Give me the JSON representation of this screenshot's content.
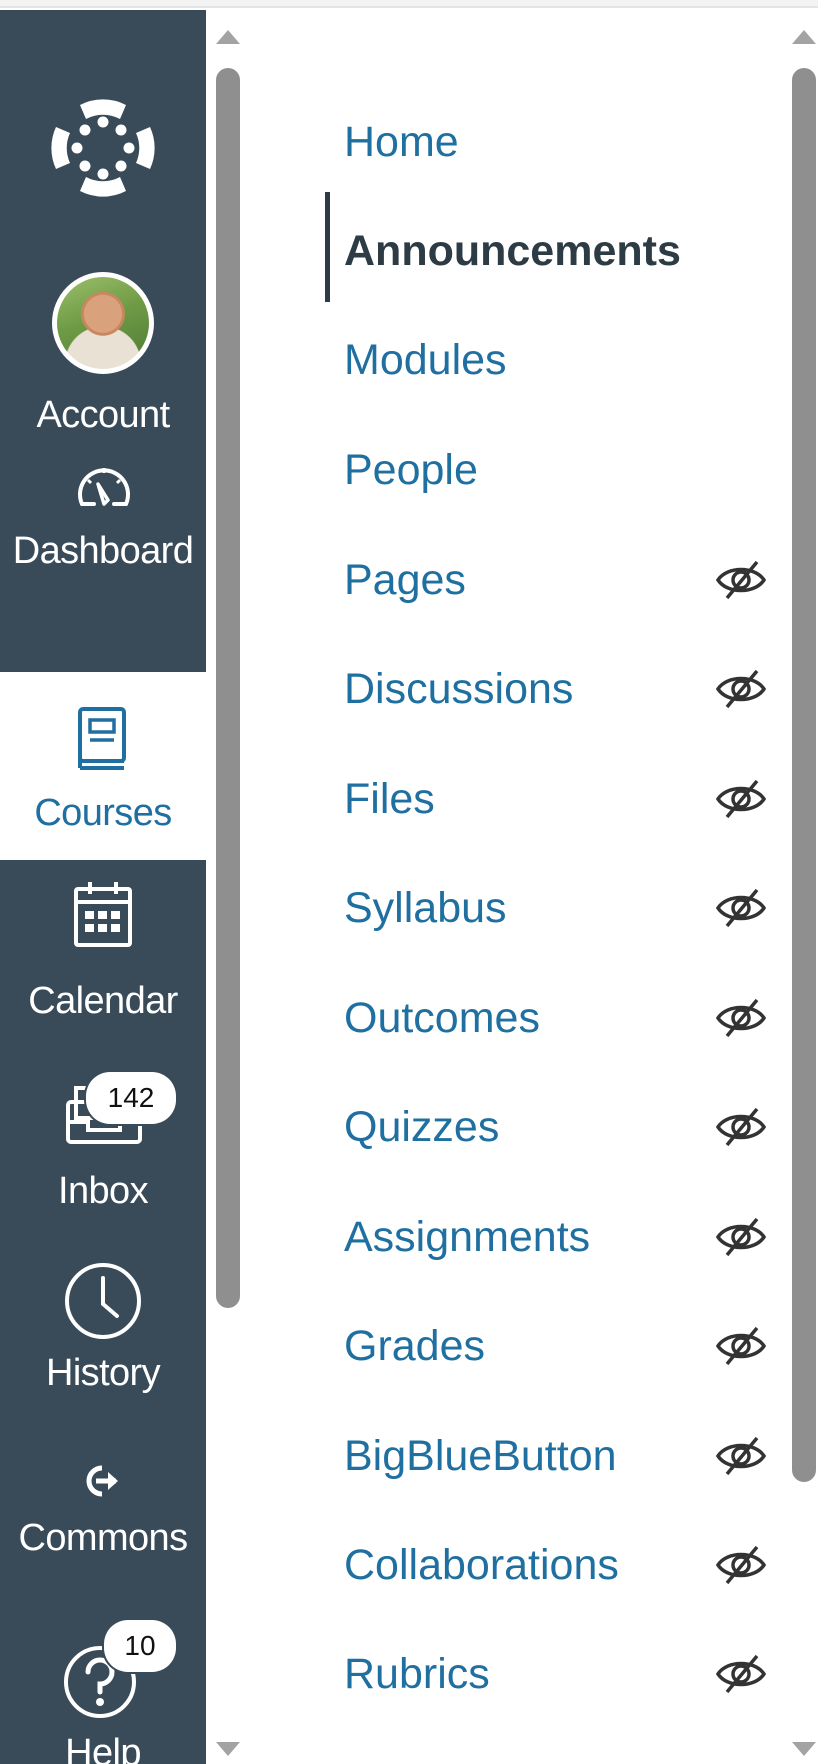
{
  "global_nav": {
    "logo_icon": "canvas-logo-icon",
    "items": [
      {
        "id": "account",
        "label": "Account",
        "icon": "avatar"
      },
      {
        "id": "dashboard",
        "label": "Dashboard",
        "icon": "dashboard-gauge-icon"
      },
      {
        "id": "courses",
        "label": "Courses",
        "icon": "book-icon",
        "active": true
      },
      {
        "id": "calendar",
        "label": "Calendar",
        "icon": "calendar-icon"
      },
      {
        "id": "inbox",
        "label": "Inbox",
        "icon": "inbox-icon",
        "badge": "142"
      },
      {
        "id": "history",
        "label": "History",
        "icon": "clock-icon"
      },
      {
        "id": "commons",
        "label": "Commons",
        "icon": "commons-icon"
      },
      {
        "id": "help",
        "label": "Help",
        "icon": "help-icon",
        "badge": "10"
      }
    ]
  },
  "course_nav": {
    "items": [
      {
        "label": "Home",
        "hidden": false
      },
      {
        "label": "Announcements",
        "hidden": false,
        "active": true
      },
      {
        "label": "Modules",
        "hidden": false
      },
      {
        "label": "People",
        "hidden": false
      },
      {
        "label": "Pages",
        "hidden": true
      },
      {
        "label": "Discussions",
        "hidden": true
      },
      {
        "label": "Files",
        "hidden": true
      },
      {
        "label": "Syllabus",
        "hidden": true
      },
      {
        "label": "Outcomes",
        "hidden": true
      },
      {
        "label": "Quizzes",
        "hidden": true
      },
      {
        "label": "Assignments",
        "hidden": true
      },
      {
        "label": "Grades",
        "hidden": true
      },
      {
        "label": "BigBlueButton",
        "hidden": true
      },
      {
        "label": "Collaborations",
        "hidden": true
      },
      {
        "label": "Rubrics",
        "hidden": true
      }
    ]
  },
  "colors": {
    "nav_background": "#394b58",
    "link_blue": "#1f6fa1",
    "active_text": "#2d3b45"
  }
}
